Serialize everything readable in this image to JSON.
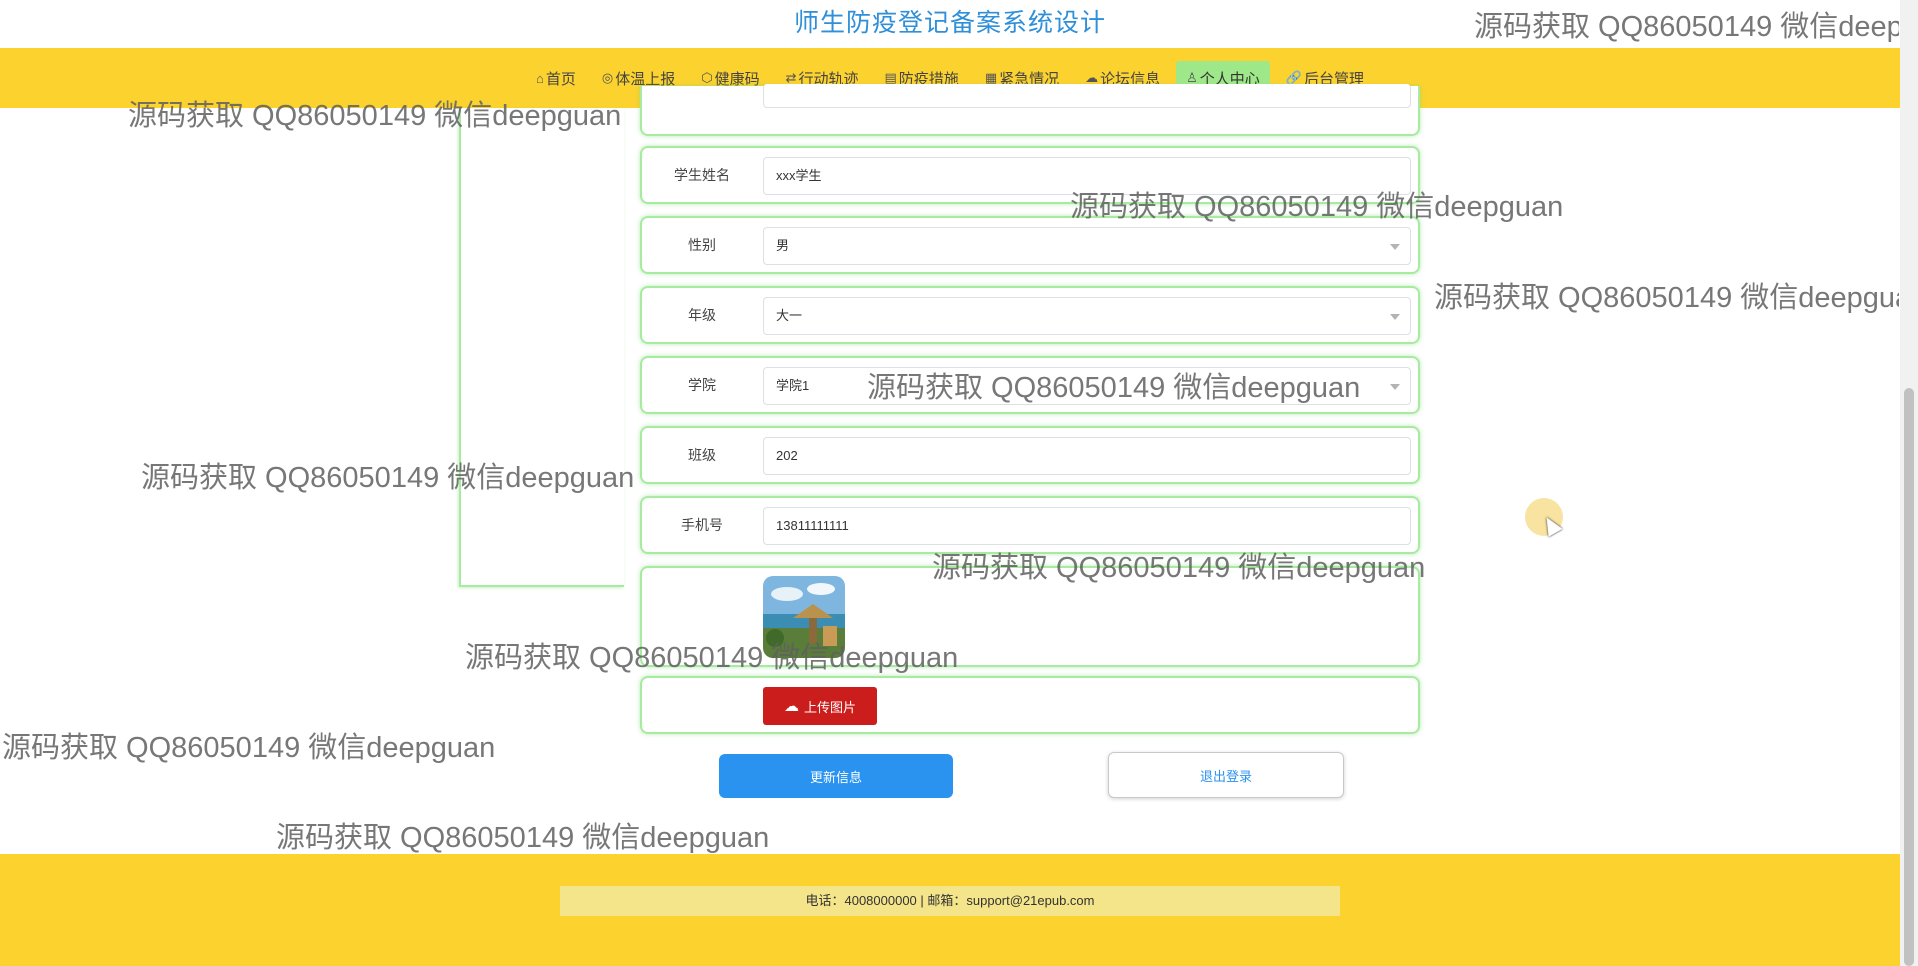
{
  "site_title": "师生防疫登记备案系统设计",
  "nav": [
    {
      "icon": "⌂",
      "label": "首页"
    },
    {
      "icon": "◎",
      "label": "体温上报"
    },
    {
      "icon": "⬡",
      "label": "健康码"
    },
    {
      "icon": "⇄",
      "label": "行动轨迹"
    },
    {
      "icon": "▤",
      "label": "防疫措施"
    },
    {
      "icon": "▦",
      "label": "紧急情况"
    },
    {
      "icon": "☁",
      "label": "论坛信息"
    },
    {
      "icon": "♙",
      "label": "个人中心"
    },
    {
      "icon": "🔗",
      "label": "后台管理"
    }
  ],
  "form": {
    "partial": {
      "label": "",
      "value": ""
    },
    "student_name": {
      "label": "学生姓名",
      "value": "xxx学生"
    },
    "gender": {
      "label": "性别",
      "value": "男"
    },
    "grade": {
      "label": "年级",
      "value": "大一"
    },
    "college": {
      "label": "学院",
      "value": "学院1"
    },
    "class": {
      "label": "班级",
      "value": "202"
    },
    "phone": {
      "label": "手机号",
      "value": "13811111111"
    }
  },
  "upload_label": "上传图片",
  "update_label": "更新信息",
  "logout_label": "退出登录",
  "footer": "电话：4008000000 | 邮箱：support@21epub.com",
  "watermark": "源码获取 QQ86050149 微信deepguan",
  "colors": {
    "nav_bg": "#fcd22e",
    "title": "#2f8fd8",
    "active_nav": "#9fe88a",
    "upload_btn": "#cc1d1d",
    "update_btn": "#2a93f0"
  }
}
